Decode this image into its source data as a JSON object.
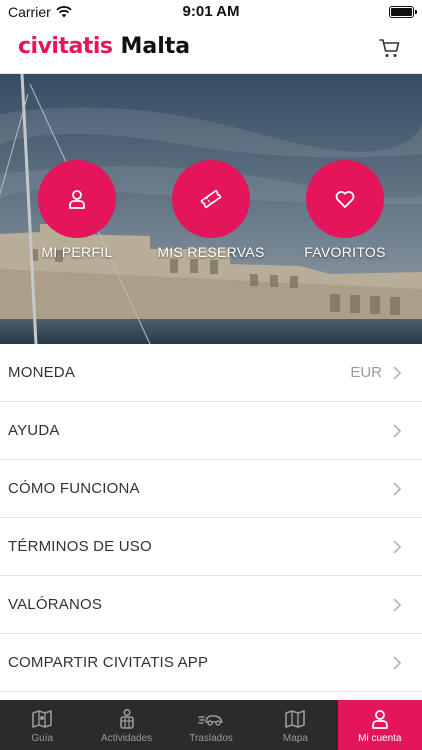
{
  "status_bar": {
    "carrier": "Carrier",
    "time": "9:01 AM"
  },
  "header": {
    "brand": "civitatis",
    "city": "Malta"
  },
  "hero": {
    "actions": [
      {
        "label": "MI PERFIL",
        "icon": "person-icon"
      },
      {
        "label": "MIS RESERVAS",
        "icon": "ticket-icon"
      },
      {
        "label": "FAVORITOS",
        "icon": "heart-icon"
      }
    ]
  },
  "menu": {
    "items": [
      {
        "label": "MONEDA",
        "value": "EUR"
      },
      {
        "label": "AYUDA"
      },
      {
        "label": "CÓMO FUNCIONA"
      },
      {
        "label": "TÉRMINOS DE USO"
      },
      {
        "label": "VALÓRANOS"
      },
      {
        "label": "COMPARTIR CIVITATIS APP"
      }
    ]
  },
  "tabs": [
    {
      "label": "Guía",
      "icon": "map-book-icon"
    },
    {
      "label": "Actividades",
      "icon": "activities-icon"
    },
    {
      "label": "Traslados",
      "icon": "car-icon"
    },
    {
      "label": "Mapa",
      "icon": "map-icon"
    },
    {
      "label": "Mi cuenta",
      "icon": "person-icon",
      "active": true
    }
  ],
  "colors": {
    "brand": "#e4155b",
    "tab_bar": "#2b2b2b"
  }
}
